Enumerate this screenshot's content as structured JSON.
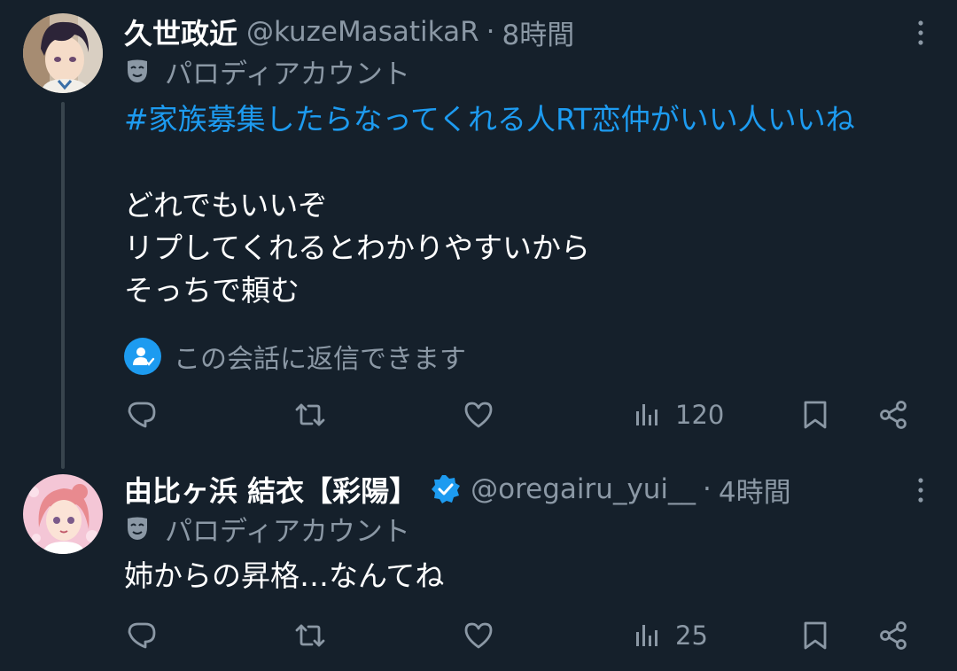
{
  "tweets": [
    {
      "display_name": "久世政近",
      "handle": "@kuzeMasatikaR",
      "separator": "·",
      "time": "8時間",
      "verified": false,
      "parody_label": "パロディアカウント",
      "hashtag": "#家族募集したらなってくれる人RT恋仲がいい人いいね",
      "body_lines": [
        "どれでもいいぞ",
        "リプしてくれるとわかりやすいから",
        "そっちで頼む"
      ],
      "reply_note": "この会話に返信できます",
      "views": "120"
    },
    {
      "display_name": "由比ヶ浜 結衣【彩陽】",
      "handle": "@oregairu_yui__",
      "separator": "·",
      "time": "4時間",
      "verified": true,
      "parody_label": "パロディアカウント",
      "body_lines": [
        "姉からの昇格…なんてね"
      ],
      "views": "25"
    }
  ],
  "colors": {
    "background": "#15202b",
    "accent": "#1d9bf0",
    "muted": "#8b98a5",
    "thread_line": "#38444d"
  },
  "icons": {
    "reply": "reply-icon",
    "retweet": "retweet-icon",
    "like": "heart-icon",
    "views": "views-icon",
    "bookmark": "bookmark-icon",
    "share": "share-icon",
    "more": "more-icon",
    "parody": "mask-icon",
    "reply_note": "person-check-icon",
    "verified": "verified-badge-icon"
  }
}
